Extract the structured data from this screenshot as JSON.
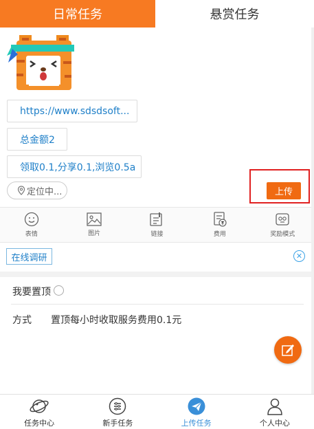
{
  "tabs": [
    {
      "label": "日常任务",
      "active": true
    },
    {
      "label": "悬赏任务",
      "active": false
    }
  ],
  "task": {
    "url": "https://www.sdsdsoft...",
    "total": "总金额2",
    "reward": "领取0.1,分享0.1,浏览0.5a",
    "location": "定位中...",
    "upload_label": "上传"
  },
  "toolbar": [
    {
      "label": "表情",
      "icon": "smile-icon"
    },
    {
      "label": "图片",
      "icon": "image-icon"
    },
    {
      "label": "链接",
      "icon": "link-icon"
    },
    {
      "label": "费用",
      "icon": "fee-icon"
    },
    {
      "label": "奖励模式",
      "icon": "reward-mode-icon"
    }
  ],
  "survey": {
    "label": "在线调研"
  },
  "options": {
    "pin_label": "我要置顶",
    "method_label": "方式",
    "method_value": "置顶每小时收取服务费用0.1元"
  },
  "bottom_nav": [
    {
      "label": "任务中心",
      "icon": "planet-icon",
      "active": false
    },
    {
      "label": "新手任务",
      "icon": "list-icon",
      "active": false
    },
    {
      "label": "上传任务",
      "icon": "paper-plane-icon",
      "active": true
    },
    {
      "label": "个人中心",
      "icon": "user-icon",
      "active": false
    }
  ],
  "colors": {
    "accent": "#f77a22",
    "link": "#1e7fc8",
    "active_nav": "#3a8fd8",
    "highlight": "#e02020"
  }
}
